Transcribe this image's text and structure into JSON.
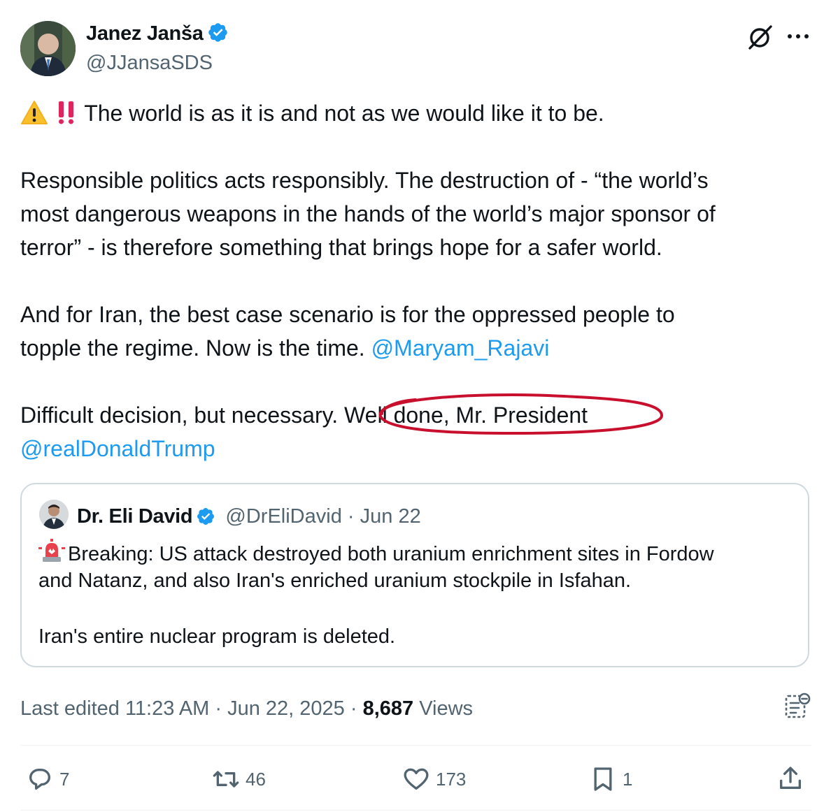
{
  "author": {
    "name": "Janez Janša",
    "handle": "@JJansaSDS"
  },
  "post": {
    "line1": "The world is as it is and not as we would like it to be.",
    "para2_line1": "Responsible politics acts responsibly. The destruction of -  “the world’s",
    "para2_line2": "most dangerous weapons in the hands of the world’s major sponsor of",
    "para2_line3": "terror” - is therefore something that brings hope for a safer world.",
    "para3_line1": "And for Iran, the best case scenario is for the oppressed people  to",
    "para3_line2_text": "topple the regime. Now is the time. ",
    "para3_line2_mention": "@Maryam_Rajavi",
    "para4_line1_text": "Difficult decision, but necessary. ",
    "para4_line1_circled": "Well done, Mr. President",
    "para4_line2_mention": "@realDonaldTrump"
  },
  "quote": {
    "name": "Dr. Eli David",
    "handle": "@DrEliDavid",
    "separator": "·",
    "date": "Jun 22",
    "line1": "Breaking: US attack destroyed both uranium enrichment sites in Fordow",
    "line2": "and Natanz, and also Iran's enriched uranium stockpile in Isfahan.",
    "line3": "Iran's entire nuclear program is deleted."
  },
  "meta": {
    "edited": "Last edited 11:23 AM · Jun 22, 2025 · ",
    "views_count": "8,687",
    "views_label": " Views"
  },
  "actions": {
    "replies": "7",
    "reposts": "46",
    "likes": "173",
    "bookmarks": "1"
  },
  "colors": {
    "link": "#1d9bf0",
    "verified": "#1d9bf0",
    "annotation_circle": "#c8102e",
    "muted": "#536471"
  },
  "icons": [
    "verified-badge-icon",
    "grok-icon",
    "more-icon",
    "warning-icon",
    "double-exclamation-icon",
    "rotating-light-icon",
    "analytics-icon",
    "reply-icon",
    "repost-icon",
    "like-icon",
    "bookmark-icon",
    "share-icon"
  ]
}
